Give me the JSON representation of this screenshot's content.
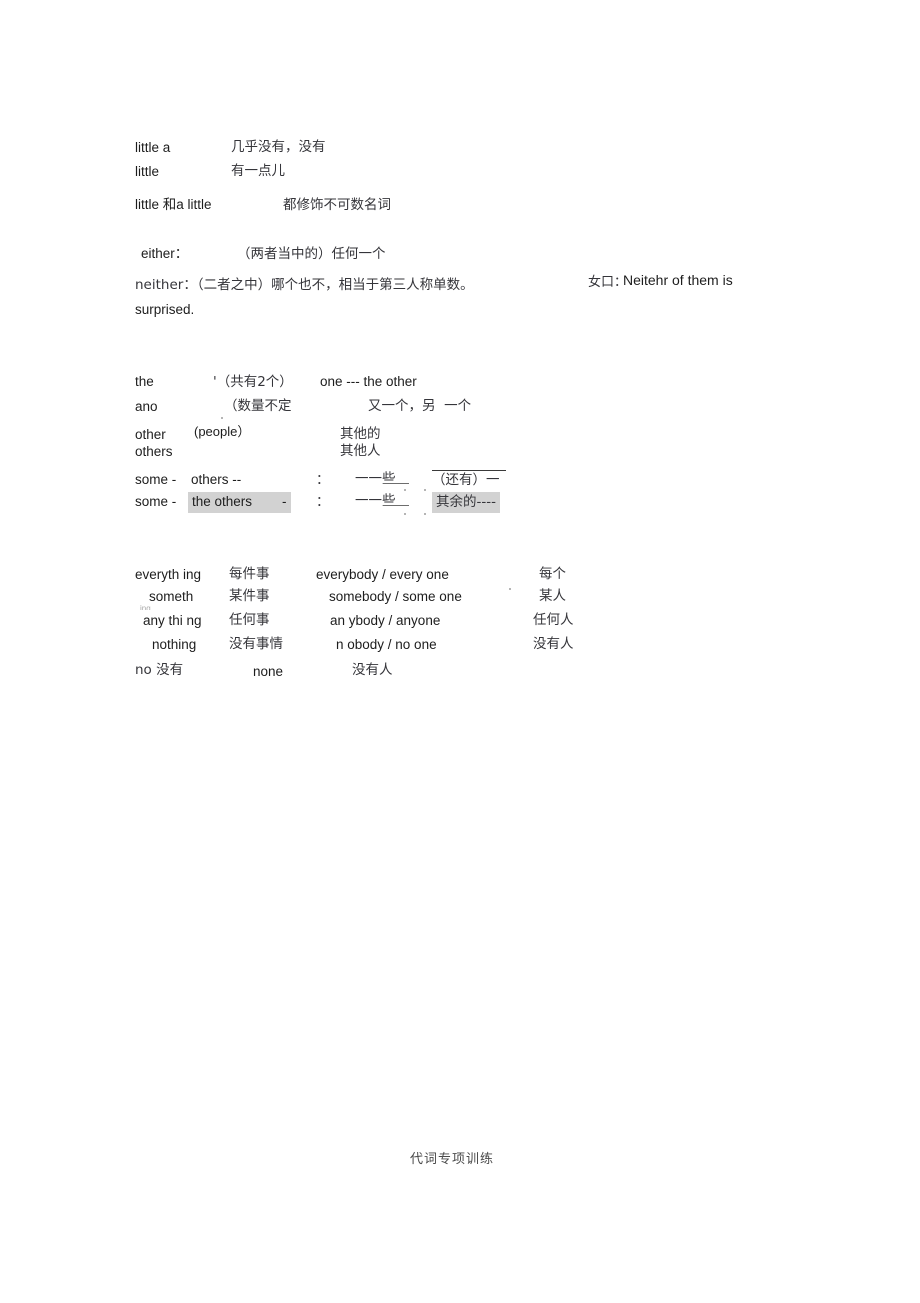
{
  "document": {
    "footer_text": "代词专项训练"
  },
  "section_little": {
    "rows": [
      {
        "term": "little a",
        "meaning": "几乎没有，没有"
      },
      {
        "term": "little",
        "meaning": "有一点儿"
      }
    ],
    "note_term": "little 和a little",
    "note_meaning": "都修饰不可数名词"
  },
  "section_either": {
    "either_term": "either：",
    "either_meaning": "（两者当中的）任何一个",
    "neither_line": "neither：（二者之中）哪个也不，相当于第三人称单数。",
    "neither_continued": "surprised.",
    "example_label": "女口：",
    "example_text": "Neitehr of them is"
  },
  "section_other": {
    "rows": [
      {
        "term": "the",
        "clip": "..",
        "note": "'（共有2个）",
        "english": "one --- the other",
        "chinese": ""
      },
      {
        "term": "ano",
        "clip": "..",
        "note": "（数量不定",
        "english": "",
        "chinese": "又一个，另  一个"
      },
      {
        "term": "other",
        "clip": "",
        "note": "(people）",
        "english": "",
        "chinese": "其他的"
      },
      {
        "term": "others",
        "clip": "",
        "note": "",
        "english": "",
        "chinese": "其他人"
      }
    ],
    "some_rows": [
      {
        "left": "some -",
        "mid": "others --",
        "colon": "：",
        "frag": "一一些",
        "right": "（还有）一",
        "highlight_mid": false,
        "highlight_right": false,
        "topline_right": true
      },
      {
        "left": "some -",
        "mid": "the others        -",
        "colon": "：",
        "frag": "一一些",
        "right": "其余的----",
        "highlight_mid": true,
        "highlight_right": true,
        "topline_right": false
      }
    ]
  },
  "section_compounds": {
    "rows": [
      {
        "thing": "everyth ing",
        "thing_cn": "每件事",
        "body": "everybody / every one",
        "body_cn": "每个"
      },
      {
        "thing": "someth",
        "thing_clip": "ing",
        "thing_cn": "某件事",
        "body": "somebody / some one",
        "body_cn": "某人"
      },
      {
        "thing": "any thi ng",
        "thing_cn": "任何事",
        "body": "an ybody / anyone",
        "body_cn": "任何人"
      },
      {
        "thing": "nothing",
        "thing_cn": "没有事情",
        "body": "n obody / no one",
        "body_cn": "没有人"
      }
    ],
    "last_row": {
      "no_term": "no 没有",
      "none_term": "none",
      "none_cn": "没有人"
    }
  },
  "colors": {
    "highlight": "#d2d2d2",
    "text": "#1d1d1d",
    "chinese_text": "#35353a",
    "faint": "#9a9a9a"
  }
}
